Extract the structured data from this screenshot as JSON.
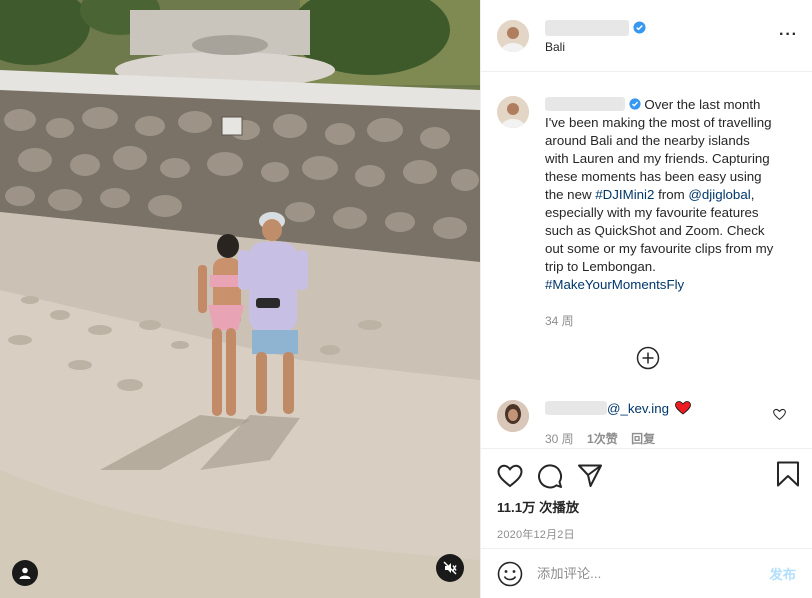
{
  "post": {
    "location": "Bali",
    "caption_lead": "Over the last month I've been making the most of travelling around Bali and the nearby islands with Lauren and my friends. Capturing these moments has been easy using the new ",
    "hashtag_1": "#DJIMini2",
    "caption_mid_1": " from ",
    "mention_1": "@djiglobal",
    "caption_mid_2": ", especially with my favourite features such as QuickShot and Zoom. Check out some or my favourite clips from my trip to Lembongan. ",
    "hashtag_2": "#MakeYourMomentsFly",
    "caption_time": "34 周"
  },
  "reply": {
    "mention": "@_kev.ing",
    "emoji": "❤️",
    "time": "30 周",
    "likes": "1次赞",
    "reply_label": "回复"
  },
  "stats": {
    "views": "11.1万 次播放",
    "date": "2020年12月2日"
  },
  "comment_box": {
    "placeholder": "添加评论...",
    "post_label": "发布"
  },
  "icons": {
    "verified": "verified-badge-icon",
    "more": "more-options-icon",
    "load_more": "plus-circle-icon",
    "like": "heart-icon",
    "comment": "comment-bubble-icon",
    "share": "paper-plane-icon",
    "save": "bookmark-icon",
    "emoji": "smiley-face-icon",
    "user_tag": "user-icon",
    "mute": "speaker-muted-icon"
  },
  "colors": {
    "link": "#00376b",
    "verified": "#3897f0",
    "heart": "#ed4956",
    "post_disabled": "#b2dffc"
  }
}
